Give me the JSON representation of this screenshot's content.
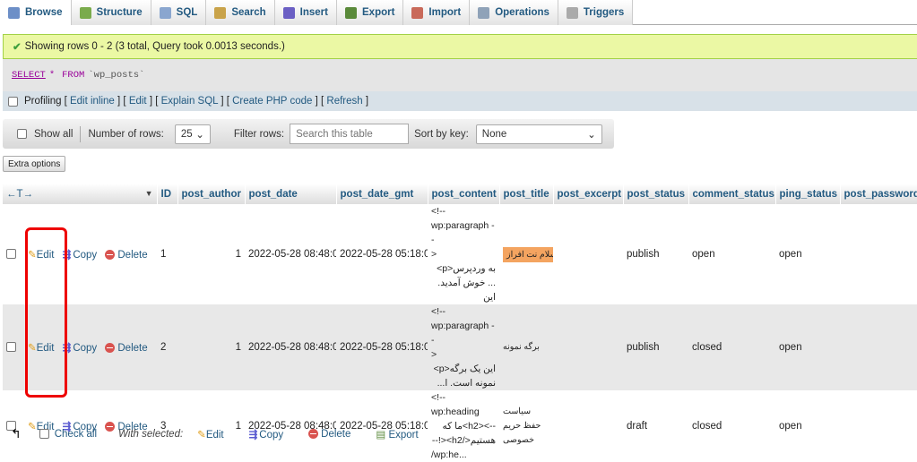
{
  "tabs": [
    {
      "label": "Browse",
      "icon": "browse-icon",
      "active": true
    },
    {
      "label": "Structure",
      "icon": "structure-icon"
    },
    {
      "label": "SQL",
      "icon": "sql-icon"
    },
    {
      "label": "Search",
      "icon": "search-icon"
    },
    {
      "label": "Insert",
      "icon": "insert-icon"
    },
    {
      "label": "Export",
      "icon": "export-icon"
    },
    {
      "label": "Import",
      "icon": "import-icon"
    },
    {
      "label": "Operations",
      "icon": "wrench-icon"
    },
    {
      "label": "Triggers",
      "icon": "triggers-icon"
    }
  ],
  "notice": "Showing rows 0 - 2 (3 total, Query took 0.0013 seconds.)",
  "sql": {
    "select": "SELECT",
    "star": "*",
    "from": "FROM",
    "table": "`wp_posts`"
  },
  "profiling": {
    "label": "Profiling",
    "links": [
      "Edit inline",
      "Edit",
      "Explain SQL",
      "Create PHP code",
      "Refresh"
    ]
  },
  "nav": {
    "show_all": "Show all",
    "rows_label": "Number of rows:",
    "rows_value": "25",
    "filter_label": "Filter rows:",
    "filter_placeholder": "Search this table",
    "sort_label": "Sort by key:",
    "sort_value": "None"
  },
  "extra_options": "Extra options",
  "columns": [
    "ID",
    "post_author",
    "post_date",
    "post_date_gmt",
    "post_content",
    "post_title",
    "post_excerpt",
    "post_status",
    "comment_status",
    "ping_status",
    "post_password"
  ],
  "actions": {
    "edit": "Edit",
    "copy": "Copy",
    "delete": "Delete"
  },
  "rows": [
    {
      "id": "1",
      "author": "1",
      "date": "2022-05-28 08:48:05",
      "gmt": "2022-05-28 05:18:05",
      "content": [
        "<!--",
        "wp:paragraph --",
        ">",
        "به وردپرس<p>",
        "... خوش آمدید. این"
      ],
      "title": "سلام نت افراز",
      "excerpt": "",
      "status": "publish",
      "comment": "open",
      "ping": "open",
      "password": ""
    },
    {
      "id": "2",
      "author": "1",
      "date": "2022-05-28 08:48:05",
      "gmt": "2022-05-28 05:18:05",
      "content": [
        "<!--",
        "wp:paragraph --",
        ">",
        "این یک برگه<p>",
        "نمونه است. ا..."
      ],
      "title": "برگه نمونه",
      "excerpt": "",
      "status": "publish",
      "comment": "closed",
      "ping": "open",
      "password": ""
    },
    {
      "id": "3",
      "author": "1",
      "date": "2022-05-28 08:48:05",
      "gmt": "2022-05-28 05:18:05",
      "content": [
        "<!-- wp:heading",
        "--><h2>ما که",
        "هستیم</h2><!--",
        "/wp:he..."
      ],
      "title": "سیاست حفظ حریم خصوصی",
      "excerpt": "",
      "status": "draft",
      "comment": "closed",
      "ping": "open",
      "password": ""
    }
  ],
  "footer": {
    "check_all": "Check all",
    "with_selected": "With selected:",
    "edit": "Edit",
    "copy": "Copy",
    "delete": "Delete",
    "export": "Export"
  },
  "colors": {
    "notice_bg": "#ebf8a4",
    "highlight": "#f4a460",
    "annotation": "#e00000",
    "link": "#235a81"
  }
}
